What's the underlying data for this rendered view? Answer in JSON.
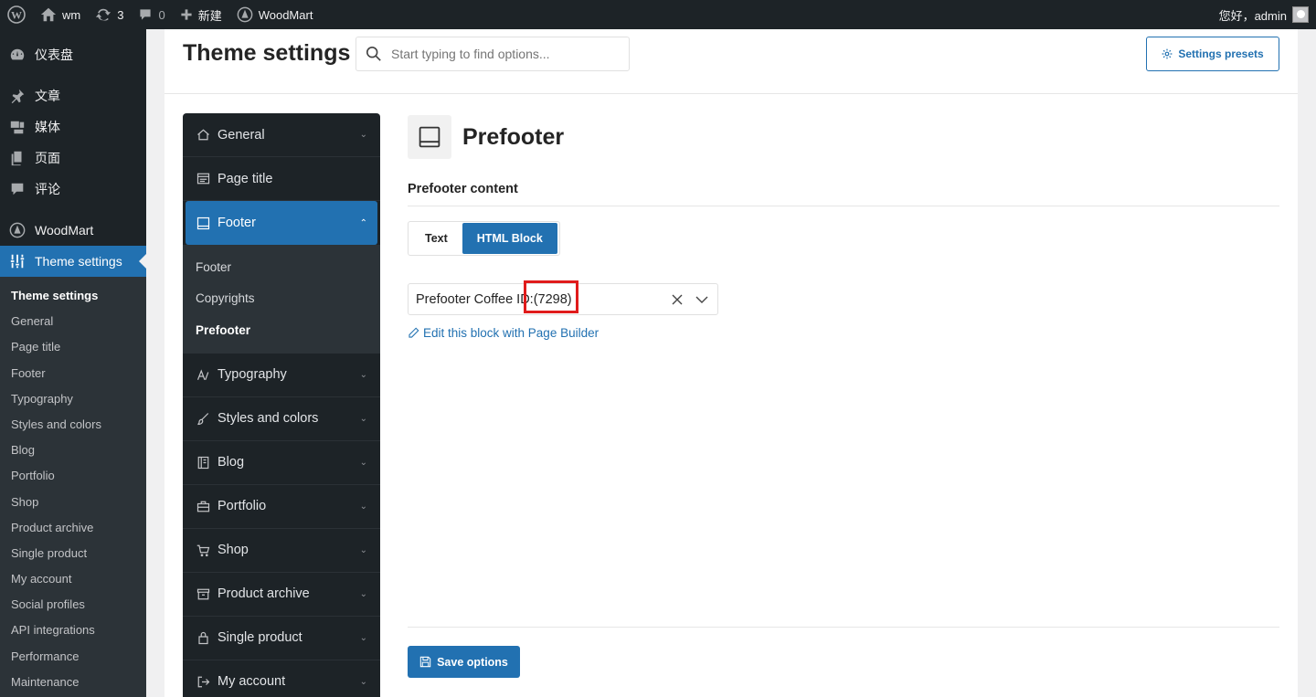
{
  "adminbar": {
    "site_name": "wm",
    "updates_count": "3",
    "comments_count": "0",
    "new_label": "新建",
    "plugin_label": "WoodMart",
    "greeting": "您好，admin"
  },
  "adminmenu": {
    "items": [
      {
        "label": "仪表盘",
        "icon": "dashboard-icon"
      },
      {
        "label": "文章",
        "icon": "pin-icon"
      },
      {
        "label": "媒体",
        "icon": "media-icon"
      },
      {
        "label": "页面",
        "icon": "page-icon"
      },
      {
        "label": "评论",
        "icon": "comment-icon"
      },
      {
        "label": "WoodMart",
        "icon": "woodmart-icon"
      },
      {
        "label": "Theme settings",
        "icon": "sliders-icon"
      }
    ],
    "submenu": [
      "Theme settings",
      "General",
      "Page title",
      "Footer",
      "Typography",
      "Styles and colors",
      "Blog",
      "Portfolio",
      "Shop",
      "Product archive",
      "Single product",
      "My account",
      "Social profiles",
      "API integrations",
      "Performance",
      "Maintenance"
    ]
  },
  "header": {
    "title": "Theme settings",
    "search_placeholder": "Start typing to find options...",
    "presets_label": "Settings presets"
  },
  "tsnav": {
    "items": [
      {
        "label": "General",
        "icon": "home-icon"
      },
      {
        "label": "Page title",
        "icon": "page-title-icon"
      },
      {
        "label": "Footer",
        "icon": "footer-icon"
      },
      {
        "label": "Typography",
        "icon": "typography-icon"
      },
      {
        "label": "Styles and colors",
        "icon": "brush-icon"
      },
      {
        "label": "Blog",
        "icon": "blog-icon"
      },
      {
        "label": "Portfolio",
        "icon": "briefcase-icon"
      },
      {
        "label": "Shop",
        "icon": "cart-icon"
      },
      {
        "label": "Product archive",
        "icon": "archive-icon"
      },
      {
        "label": "Single product",
        "icon": "bag-icon"
      },
      {
        "label": "My account",
        "icon": "login-icon"
      }
    ],
    "footer_sub": [
      "Footer",
      "Copyrights",
      "Prefooter"
    ]
  },
  "section": {
    "title": "Prefooter",
    "field_label": "Prefooter content",
    "tabs": [
      "Text",
      "HTML Block"
    ],
    "selected_value": "Prefooter Coffee ID:(7298)",
    "edit_link": "Edit this block with Page Builder",
    "save_label": "Save options"
  }
}
